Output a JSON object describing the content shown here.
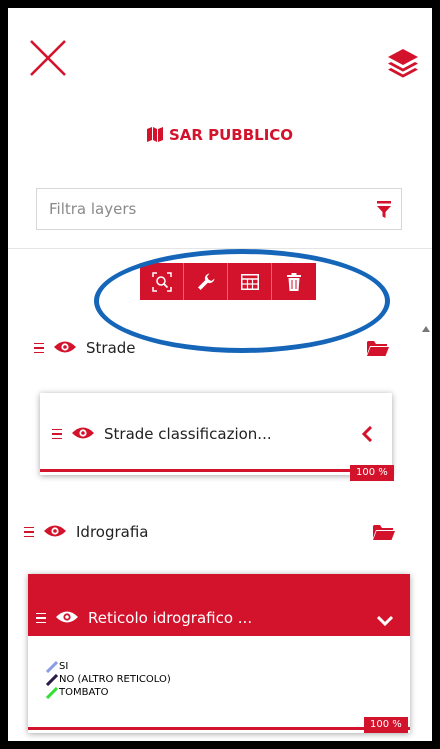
{
  "header": {
    "close_icon": "close-icon",
    "layers_icon": "layers-icon",
    "title": "SAR PUBBLICO",
    "title_icon": "map-icon"
  },
  "filter": {
    "placeholder": "Filtra layers",
    "value": "",
    "icon": "filter-icon"
  },
  "toolbar": {
    "buttons": [
      "zoom-to-layer-icon",
      "wrench-icon",
      "table-icon",
      "trash-icon"
    ]
  },
  "layers": {
    "group_strade": {
      "label": "Strade",
      "icon": "folder-open-icon"
    },
    "strade_class": {
      "label": "Strade classificazion...",
      "progress": "100 %",
      "progress_value": 100,
      "toggle_icon": "chevron-left-icon"
    },
    "group_idro": {
      "label": "Idrografia",
      "icon": "folder-open-icon"
    },
    "reticolo": {
      "label": "Reticolo idrografico ...",
      "progress": "100 %",
      "progress_value": 100,
      "toggle_icon": "chevron-down-icon"
    }
  },
  "legend": {
    "items": [
      {
        "label": "SI",
        "color": "#8a9de6"
      },
      {
        "label": "NO (ALTRO RETICOLO)",
        "color": "#2b1a45"
      },
      {
        "label": "TOMBATO",
        "color": "#33e033"
      }
    ]
  },
  "colors": {
    "accent": "#d3122c",
    "annotation_ring": "#1565b8"
  }
}
